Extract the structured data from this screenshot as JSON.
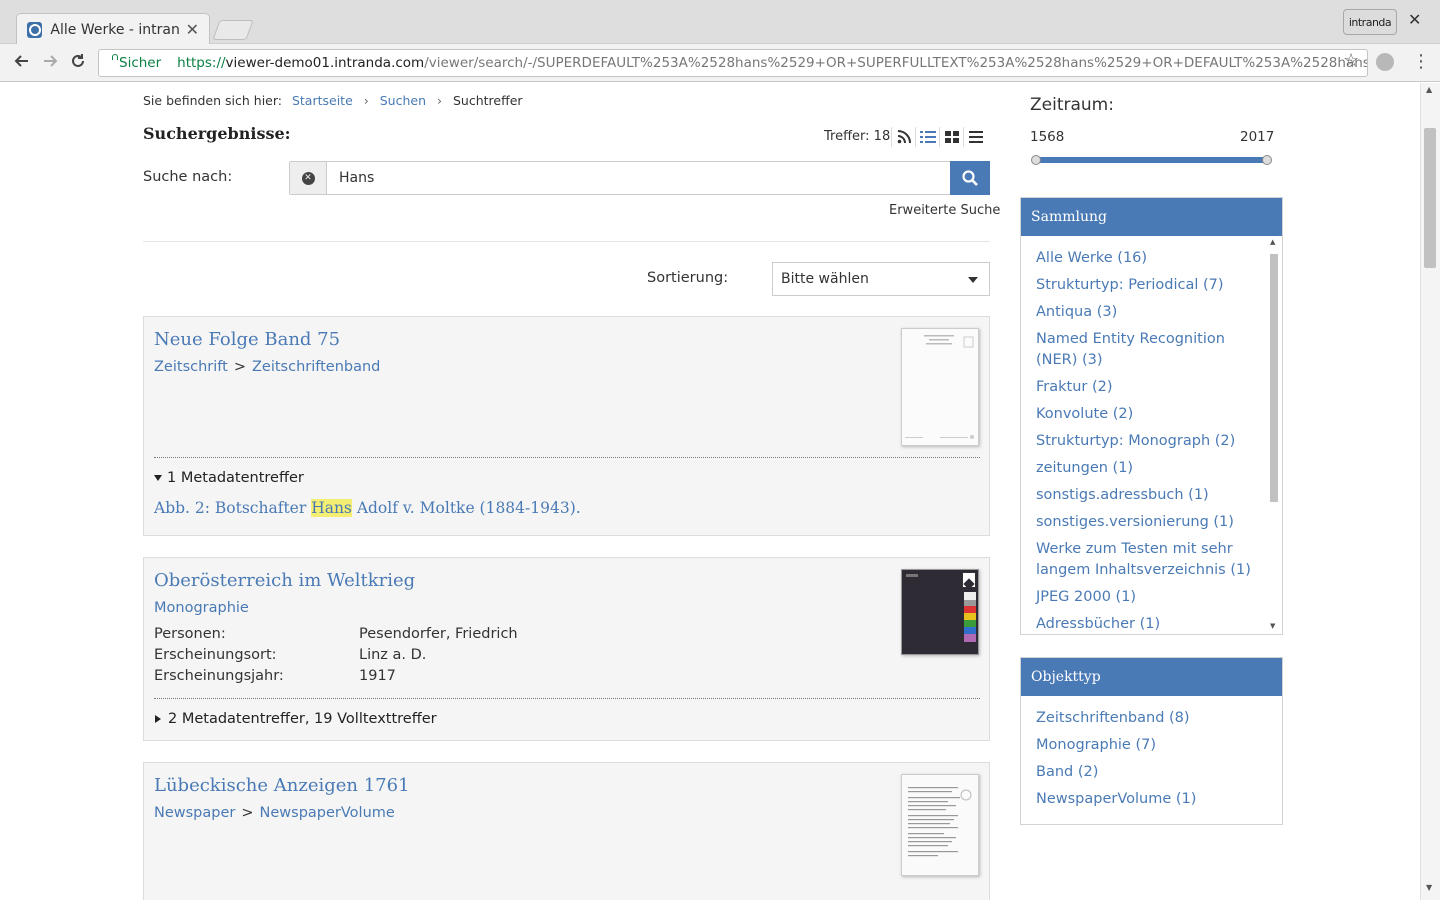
{
  "browser": {
    "tab_title": "Alle Werke - intranda",
    "profile_label": "intranda",
    "secure_label": "Sicher",
    "url_scheme": "https://",
    "url_host": "viewer-demo01.intranda.com",
    "url_path": "/viewer/search/-/SUPERDEFAULT%253A%2528hans%2529+OR+SUPERFULLTEXT%253A%2528hans%2529+OR+DEFAULT%253A%2528hans%2529+..."
  },
  "breadcrumb": {
    "prefix": "Sie befinden sich hier:",
    "items": [
      "Startseite",
      "Suchen",
      "Suchtreffer"
    ]
  },
  "results": {
    "heading": "Suchergebnisse:",
    "hits_label": "Treffer: 18"
  },
  "search": {
    "label": "Suche nach:",
    "value": "Hans",
    "advanced_label": "Erweiterte Suche"
  },
  "sort": {
    "label": "Sortierung:",
    "selected": "Bitte wählen"
  },
  "cards": [
    {
      "title": "Neue Folge Band 75",
      "type_parts": [
        "Zeitschrift",
        "Zeitschriftenband"
      ],
      "hits_toggle": "1 Metadatentreffer",
      "hit_pre": "Abb. 2: Botschafter ",
      "hit_highlight": "Hans",
      "hit_post": " Adolf v. Moltke (1884-1943)."
    },
    {
      "title": "Oberösterreich im Weltkrieg",
      "type_parts": [
        "Monographie"
      ],
      "meta": [
        {
          "label": "Personen:",
          "value": "Pesendorfer, Friedrich"
        },
        {
          "label": "Erscheinungsort:",
          "value": "Linz a. D."
        },
        {
          "label": "Erscheinungsjahr:",
          "value": "1917"
        }
      ],
      "hits_toggle": "2 Metadatentreffer, 19 Volltexttreffer"
    },
    {
      "title": "Lübeckische Anzeigen 1761",
      "type_parts": [
        "Newspaper",
        "NewspaperVolume"
      ]
    }
  ],
  "timerange": {
    "heading": "Zeitraum:",
    "from": "1568",
    "to": "2017"
  },
  "facets": {
    "collection": {
      "heading": "Sammlung",
      "items": [
        "Alle Werke (16)",
        "Strukturtyp: Periodical (7)",
        "Antiqua (3)",
        "Named Entity Recognition (NER) (3)",
        "Fraktur (2)",
        "Konvolute (2)",
        "Strukturtyp: Monograph (2)",
        "zeitungen (1)",
        "sonstigs.adressbuch (1)",
        "sonstiges.versionierung (1)",
        "Werke zum Testen mit sehr langem Inhaltsverzeichnis (1)",
        "JPEG 2000 (1)",
        "Adressbücher (1)"
      ]
    },
    "objecttype": {
      "heading": "Objekttyp",
      "items": [
        "Zeitschriftenband (8)",
        "Monographie (7)",
        "Band (2)",
        "NewspaperVolume (1)"
      ]
    }
  }
}
